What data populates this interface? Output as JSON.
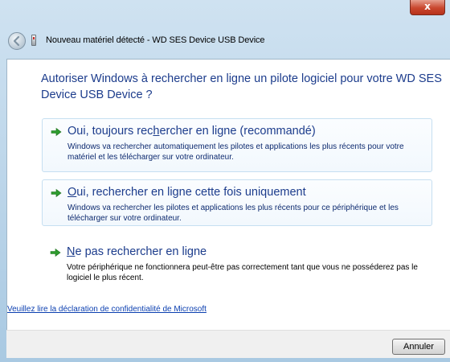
{
  "window": {
    "title": "Nouveau matériel détecté - WD SES Device USB Device",
    "close_glyph": "x"
  },
  "question": "Autoriser Windows à rechercher en ligne un pilote logiciel pour votre WD SES Device USB Device ?",
  "options": [
    {
      "title_before": "Oui, toujours rec",
      "title_accel": "h",
      "title_after": "ercher en ligne (recommandé)",
      "description": "Windows va rechercher automatiquement les pilotes et applications les plus récents pour votre matériel et les télécharger sur votre ordinateur."
    },
    {
      "title_before": "",
      "title_accel": "O",
      "title_after": "ui, rechercher en ligne cette fois uniquement",
      "description": "Windows va rechercher les pilotes et applications les plus récents pour ce périphérique et les télécharger sur votre ordinateur."
    },
    {
      "title_before": "",
      "title_accel": "N",
      "title_after": "e pas rechercher en ligne",
      "description": "Votre périphérique ne fonctionnera peut-être pas correctement tant que vous ne posséderez pas le logiciel le plus récent."
    }
  ],
  "privacy_link": "Veuillez lire la déclaration de confidentialité de Microsoft",
  "buttons": {
    "cancel": "Annuler"
  },
  "icons": {
    "back": "back-arrow-icon",
    "device": "usb-device-icon",
    "option": "green-arrow-icon",
    "close": "close-icon"
  },
  "colors": {
    "link_blue": "#1c3c8c",
    "arrow_green": "#2e9c2e",
    "close_red": "#c9472e"
  }
}
